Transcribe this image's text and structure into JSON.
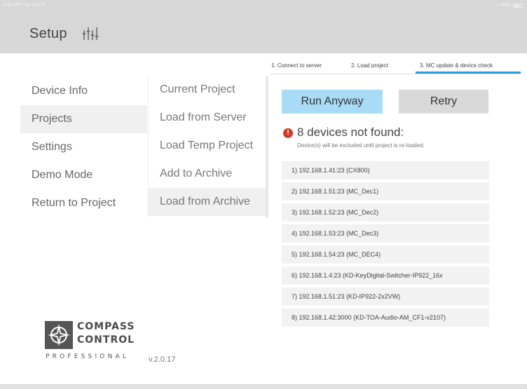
{
  "status_bar": {
    "time": "2:44 PM  Tue Dec 5",
    "battery": "65%"
  },
  "header": {
    "title": "Setup",
    "icon": "sliders-icon"
  },
  "menu": {
    "items": [
      {
        "label": "Device Info"
      },
      {
        "label": "Projects"
      },
      {
        "label": "Settings"
      },
      {
        "label": "Demo Mode"
      },
      {
        "label": "Return to Project"
      }
    ],
    "active_index": 1
  },
  "submenu": {
    "items": [
      {
        "label": "Current Project"
      },
      {
        "label": "Load from Server"
      },
      {
        "label": "Load Temp Project"
      },
      {
        "label": "Add to Archive"
      },
      {
        "label": "Load from Archive"
      }
    ],
    "active_index": 4
  },
  "tabs": [
    {
      "label": "1. Connect to server"
    },
    {
      "label": "2. Load project"
    },
    {
      "label": "3. MC update & device check"
    }
  ],
  "active_tab": 2,
  "buttons": {
    "run_anyway": "Run Anyway",
    "retry": "Retry"
  },
  "warning": {
    "icon": "!",
    "title": "8 devices not found:",
    "subtitle": "Device(s) will be excluded until project is re-loaded."
  },
  "devices": [
    "1)  192.168.1.41:23 (CX800)",
    "2)  192.168.1.51:23 (MC_Dec1)",
    "3)  192.168.1.52:23 (MC_Dec2)",
    "4)  192.168.1.53:23 (MC_Dec3)",
    "5)  192.168.1.54:23 (MC_DEC4)",
    "6)  192.168.1.4:23 (KD-KeyDigital-Switcher-IP922_16x",
    "7)  192.168.1.51:23 (KD-IP922-2x2VW)",
    "8)  192.168.1.42:3000 (KD-TOA-Audio-AM_CF1-v2107)"
  ],
  "logo": {
    "line1": "COMPASS",
    "line2": "CONTROL",
    "line3": "PROFESSIONAL"
  },
  "version": "v.2.0.17",
  "colors": {
    "accent": "#2a9fd6",
    "run_button": "#a8dcf6",
    "retry_button": "#d9d9d9",
    "warning": "#d23a2a",
    "header_bg": "#d7d7d7"
  }
}
